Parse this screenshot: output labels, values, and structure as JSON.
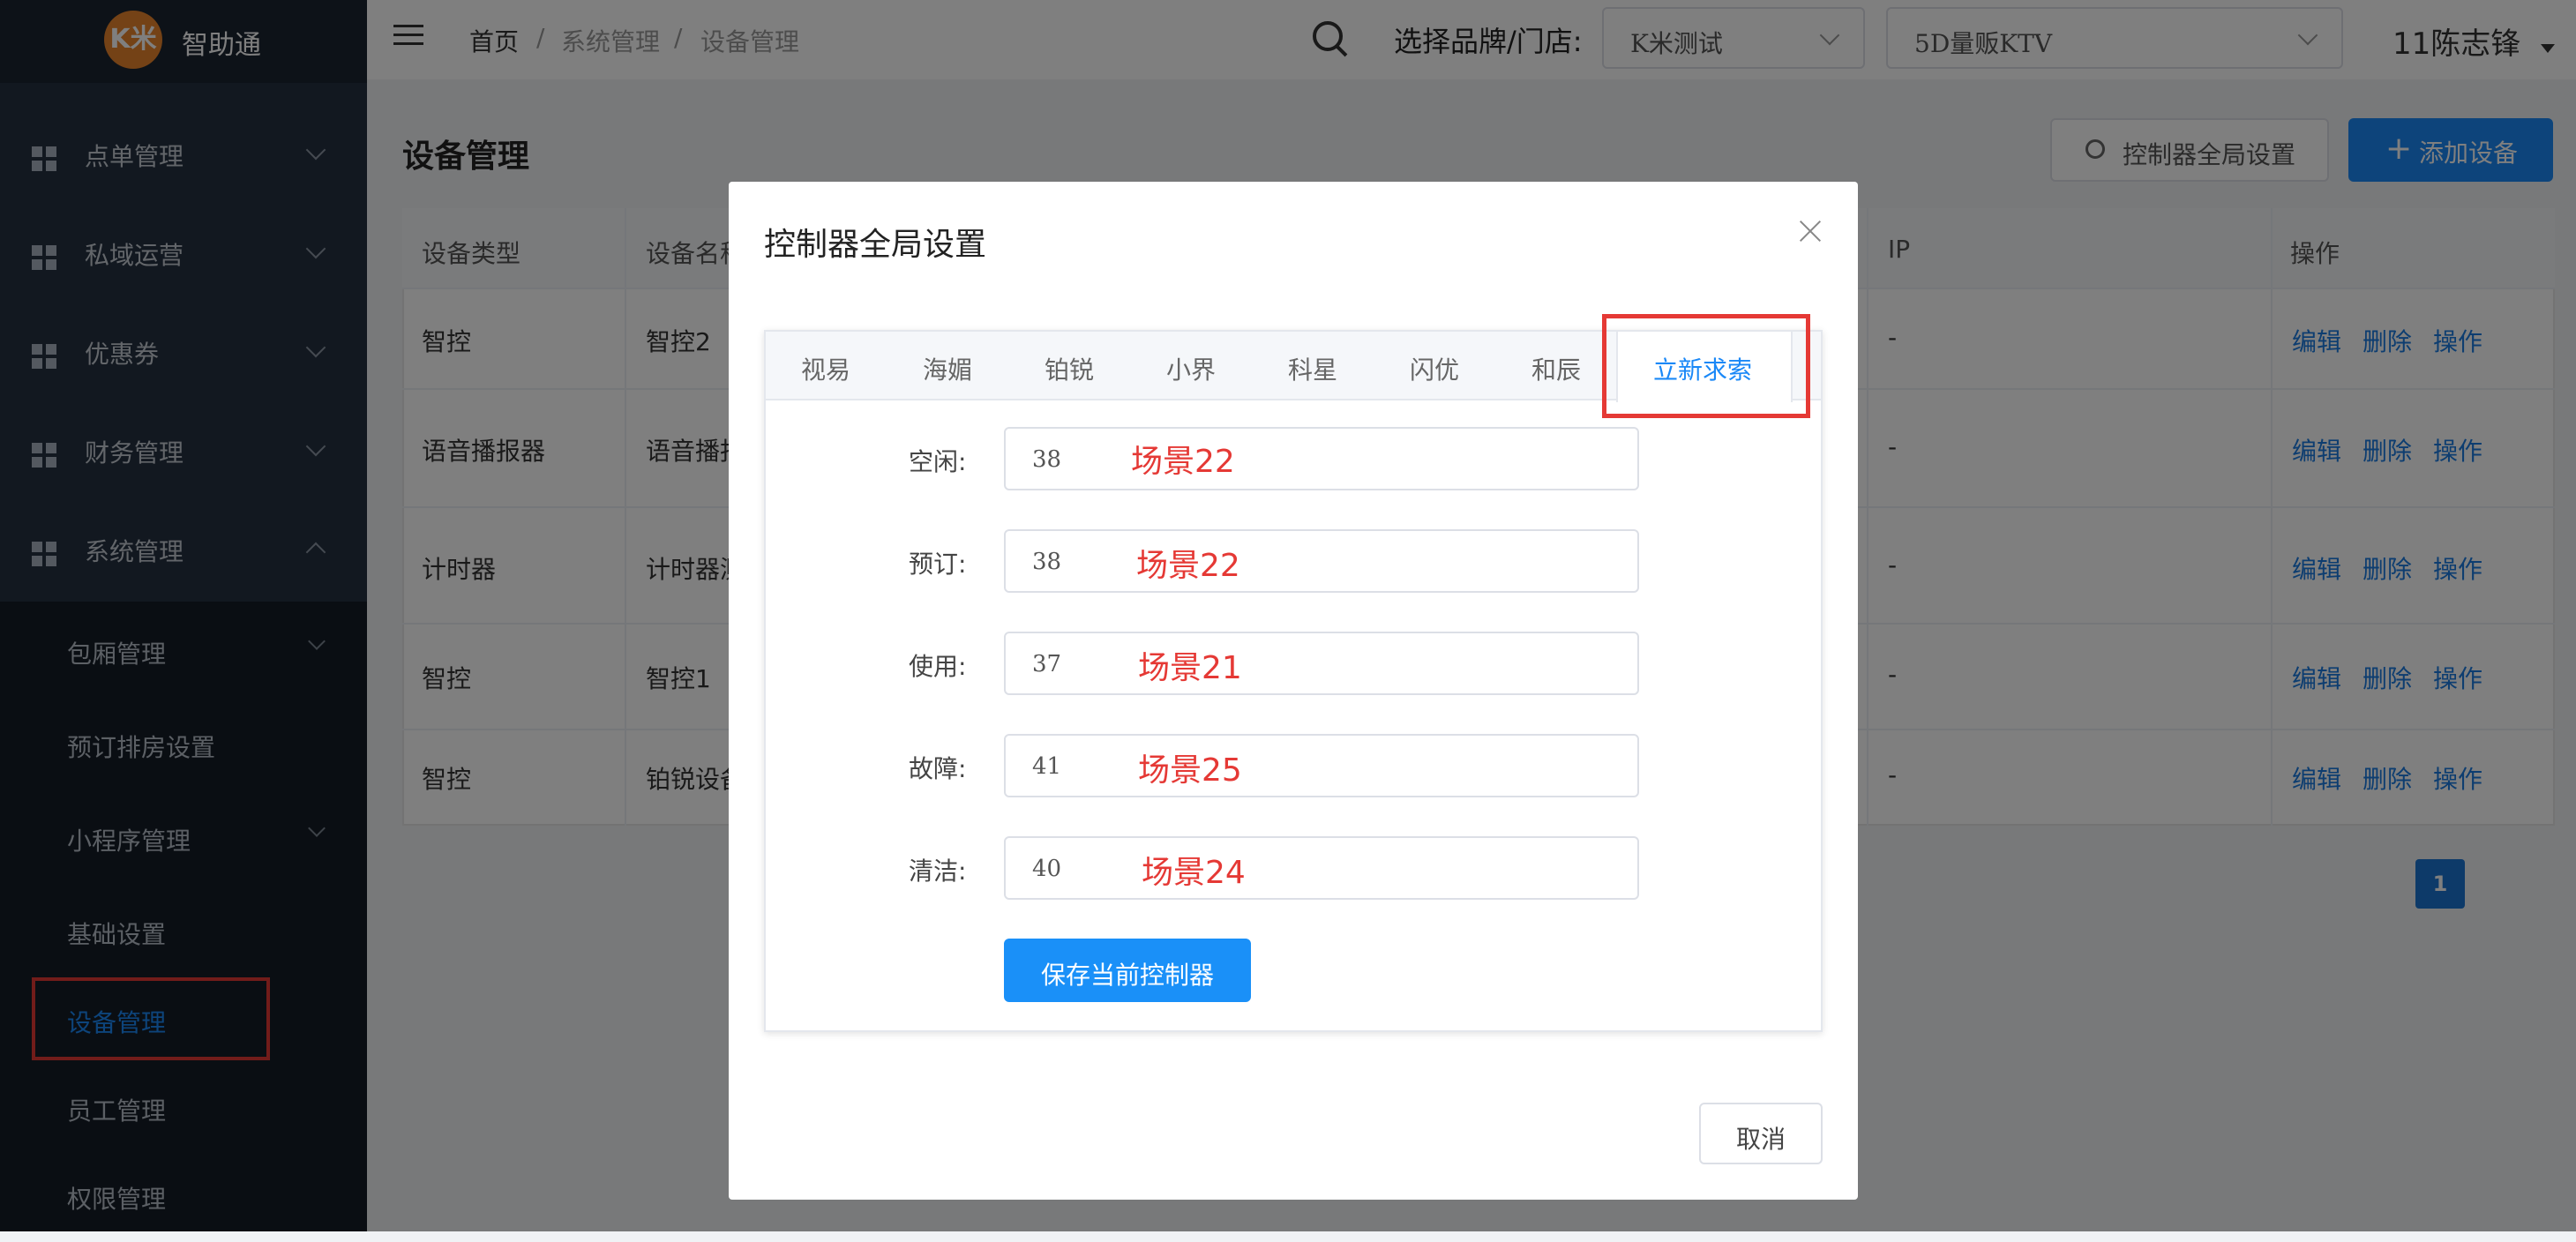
{
  "app": {
    "logo": "K米",
    "name": "智助通"
  },
  "sidebar": {
    "menus": [
      {
        "label": "点单管理"
      },
      {
        "label": "私域运营"
      },
      {
        "label": "优惠券"
      },
      {
        "label": "财务管理"
      },
      {
        "label": "系统管理"
      }
    ],
    "submenu": [
      {
        "label": "包厢管理"
      },
      {
        "label": "预订排房设置"
      },
      {
        "label": "小程序管理"
      },
      {
        "label": "基础设置"
      },
      {
        "label": "设备管理"
      },
      {
        "label": "员工管理"
      },
      {
        "label": "权限管理"
      }
    ]
  },
  "header": {
    "breadcrumb": [
      "首页",
      "/",
      "系统管理",
      "/",
      "设备管理"
    ],
    "brand_label": "选择品牌/门店:",
    "brand_select": "K米测试",
    "store_select": "5D量贩KTV",
    "user": "11陈志锋"
  },
  "page": {
    "title": "设备管理",
    "global_btn": "控制器全局设置",
    "add_btn": "添加设备",
    "add_icon": "+",
    "columns": [
      "设备类型",
      "设备名称",
      "IP",
      "操作"
    ],
    "rows": [
      {
        "type": "智控",
        "name": "智控2",
        "ip": "-"
      },
      {
        "type": "语音播报器",
        "name": "语音播报",
        "ip": "-"
      },
      {
        "type": "计时器",
        "name": "计时器测",
        "ip": "-"
      },
      {
        "type": "智控",
        "name": "智控1",
        "ip": "-"
      },
      {
        "type": "智控",
        "name": "铂锐设备",
        "ip": "-"
      }
    ],
    "actions": [
      "编辑",
      "删除",
      "操作"
    ],
    "page_current": "1"
  },
  "modal": {
    "title": "控制器全局设置",
    "tabs": [
      "视易",
      "海媚",
      "铂锐",
      "小界",
      "科星",
      "闪优",
      "和辰",
      "立新求索"
    ],
    "active_tab": "立新求索",
    "fields": [
      {
        "label": "空闲:",
        "value": "38",
        "note": "场景22"
      },
      {
        "label": "预订:",
        "value": "38",
        "note": "场景22"
      },
      {
        "label": "使用:",
        "value": "37",
        "note": "场景21"
      },
      {
        "label": "故障:",
        "value": "41",
        "note": "场景25"
      },
      {
        "label": "清洁:",
        "value": "40",
        "note": "场景24"
      }
    ],
    "save_btn": "保存当前控制器",
    "cancel_btn": "取消"
  },
  "colors": {
    "primary": "#1a88f7",
    "highlight": "#e53935",
    "sidebar": "#243040"
  }
}
